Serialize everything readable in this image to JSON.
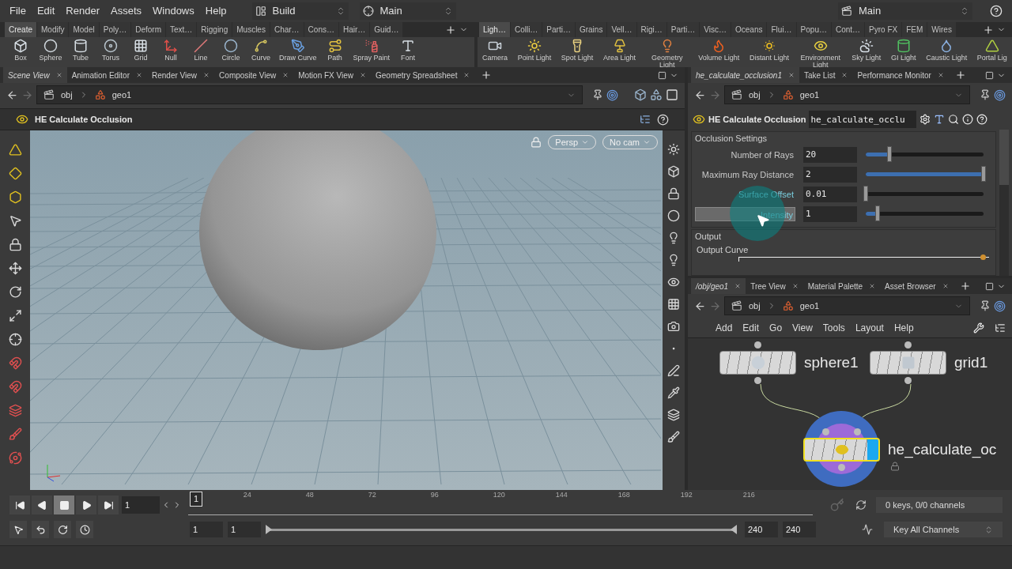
{
  "menubar": {
    "menus": [
      "File",
      "Edit",
      "Render",
      "Assets",
      "Windows",
      "Help"
    ],
    "desktop": "Build",
    "context": "Main",
    "right_context": "Main"
  },
  "shelf_left": {
    "tabs": [
      {
        "label": "Create",
        "selected": true
      },
      {
        "label": "Modify",
        "selected": false
      },
      {
        "label": "Model",
        "selected": false
      },
      {
        "label": "Poly…",
        "selected": false
      },
      {
        "label": "Deform",
        "selected": false
      },
      {
        "label": "Text…",
        "selected": false
      },
      {
        "label": "Rigging",
        "selected": false
      },
      {
        "label": "Muscles",
        "selected": false
      },
      {
        "label": "Char…",
        "selected": false
      },
      {
        "label": "Cons…",
        "selected": false
      },
      {
        "label": "Hair…",
        "selected": false
      },
      {
        "label": "Guid…",
        "selected": false
      }
    ],
    "tools": [
      "Box",
      "Sphere",
      "Tube",
      "Torus",
      "Grid",
      "Null",
      "Line",
      "Circle",
      "Curve",
      "Draw Curve",
      "Path",
      "Spray Paint",
      "Font"
    ]
  },
  "shelf_right": {
    "tabs": [
      {
        "label": "Ligh…",
        "selected": true
      },
      {
        "label": "Colli…",
        "selected": false
      },
      {
        "label": "Parti…",
        "selected": false
      },
      {
        "label": "Grains",
        "selected": false
      },
      {
        "label": "Vell…",
        "selected": false
      },
      {
        "label": "Rigi…",
        "selected": false
      },
      {
        "label": "Parti…",
        "selected": false
      },
      {
        "label": "Visc…",
        "selected": false
      },
      {
        "label": "Oceans",
        "selected": false
      },
      {
        "label": "Flui…",
        "selected": false
      },
      {
        "label": "Popu…",
        "selected": false
      },
      {
        "label": "Cont…",
        "selected": false
      },
      {
        "label": "Pyro FX",
        "selected": false
      },
      {
        "label": "FEM",
        "selected": false
      },
      {
        "label": "Wires",
        "selected": false
      }
    ],
    "tools": [
      "Camera",
      "Point Light",
      "Spot Light",
      "Area Light",
      "Geometry Light",
      "Volume Light",
      "Distant Light",
      "Environment Light",
      "Sky Light",
      "GI Light",
      "Caustic Light",
      "Portal Lig"
    ]
  },
  "scene_pane": {
    "tabs": [
      {
        "label": "Scene View",
        "selected": true
      },
      {
        "label": "Animation Editor",
        "selected": false
      },
      {
        "label": "Render View",
        "selected": false
      },
      {
        "label": "Composite View",
        "selected": false
      },
      {
        "label": "Motion FX View",
        "selected": false
      },
      {
        "label": "Geometry Spreadsheet",
        "selected": false
      }
    ],
    "path": [
      "obj",
      "geo1"
    ],
    "operation": "HE Calculate Occlusion",
    "camera_menus": [
      "Persp",
      "No cam"
    ]
  },
  "parameter_pane": {
    "tabs": [
      {
        "label": "he_calculate_occlusion1",
        "selected": true
      },
      {
        "label": "Take List",
        "selected": false
      },
      {
        "label": "Performance Monitor",
        "selected": false
      }
    ],
    "path": [
      "obj",
      "geo1"
    ],
    "node_type": "HE Calculate Occlusion",
    "node_name": "he_calculate_occlu",
    "folder": "Occlusion Settings",
    "params": [
      {
        "label": "Number of Rays",
        "value": "20",
        "level": 0.2,
        "highlighted": false,
        "pressed": false
      },
      {
        "label": "Maximum Ray Distance",
        "value": "2",
        "level": 1,
        "highlighted": false,
        "pressed": false
      },
      {
        "label": "Surface Offset",
        "value": "0.01",
        "level": 0,
        "highlighted": true,
        "pressed": false
      },
      {
        "label": "Intensity",
        "value": "1",
        "level": 0.1,
        "highlighted": true,
        "pressed": true
      }
    ],
    "output_folder": "Output",
    "ramp_label": "Output Curve"
  },
  "network_pane": {
    "tabs": [
      {
        "label": "/obj/geo1",
        "selected": true
      },
      {
        "label": "Tree View",
        "selected": false
      },
      {
        "label": "Material Palette",
        "selected": false
      },
      {
        "label": "Asset Browser",
        "selected": false
      }
    ],
    "path": [
      "obj",
      "geo1"
    ],
    "menus": [
      "Add",
      "Edit",
      "Go",
      "View",
      "Tools",
      "Layout",
      "Help"
    ],
    "nodes": [
      {
        "name": "sphere1",
        "selected": false,
        "display": false,
        "locked": false
      },
      {
        "name": "grid1",
        "selected": false,
        "display": false,
        "locked": false
      },
      {
        "name": "he_calculate_oc",
        "selected": true,
        "display": true,
        "locked": true
      }
    ]
  },
  "timeline": {
    "current_frame": "1",
    "ruler_marker": "1",
    "ruler_labels": [
      "24",
      "48",
      "72",
      "96",
      "120",
      "144",
      "168",
      "192",
      "216"
    ],
    "start": "1",
    "range_start": "1",
    "range_bar": {
      "level": 1
    },
    "range_end": "240",
    "end": "240",
    "keys_status": "0 keys, 0/0 channels",
    "key_menu": "Key All Channels"
  }
}
